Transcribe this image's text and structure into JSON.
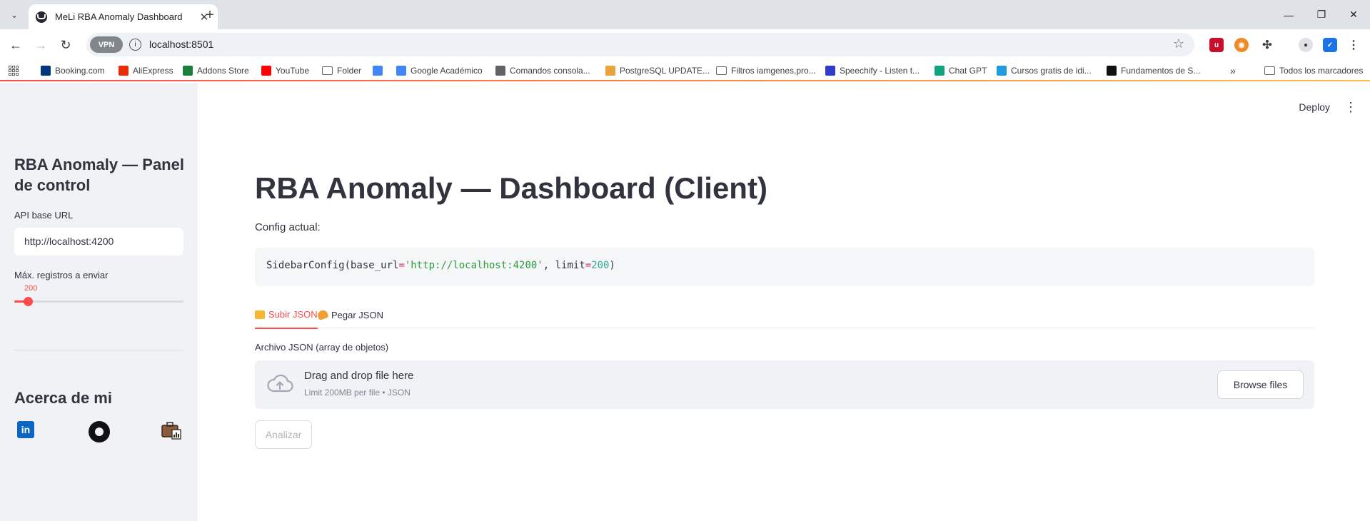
{
  "browser": {
    "tab_title": "MeLi RBA Anomaly Dashboard",
    "url": "localhost:8501",
    "vpn_label": "VPN",
    "bookmarks": [
      {
        "label": "Booking.com",
        "icon": "booking-icon",
        "color": "#003580"
      },
      {
        "label": "AliExpress",
        "icon": "aliexpress-icon",
        "color": "#e62e04"
      },
      {
        "label": "Addons Store",
        "icon": "addons-icon",
        "color": "#1a7f3c"
      },
      {
        "label": "YouTube",
        "icon": "youtube-icon",
        "color": "#ff0000"
      },
      {
        "label": "Folder",
        "icon": "folder-icon",
        "color": "#5f6368"
      },
      {
        "label": "",
        "icon": "grid-app-icon",
        "color": "#4285f4"
      },
      {
        "label": "Google Académico",
        "icon": "google-icon",
        "color": "#4285f4"
      },
      {
        "label": "Comandos consola...",
        "icon": "doc-icon",
        "color": "#5f6368"
      },
      {
        "label": "PostgreSQL UPDATE...",
        "icon": "chrome-icon",
        "color": "#e8a33d"
      },
      {
        "label": "Filtros iamgenes,pro...",
        "icon": "folder-icon",
        "color": "#5f6368"
      },
      {
        "label": "Speechify - Listen t...",
        "icon": "speechify-icon",
        "color": "#2f3bc9"
      },
      {
        "label": "Chat GPT",
        "icon": "chatgpt-icon",
        "color": "#10a37f"
      },
      {
        "label": "Cursos gratis de idi...",
        "icon": "cursos-icon",
        "color": "#1f9bde"
      },
      {
        "label": "Fundamentos de S...",
        "icon": "fundamentos-icon",
        "color": "#111111"
      }
    ],
    "all_bookmarks": "Todos los marcadores"
  },
  "sidebar": {
    "title": "RBA Anomaly — Panel de control",
    "api_label": "API base URL",
    "api_value": "http://localhost:4200",
    "limit_label": "Máx. registros a enviar",
    "limit_value": "200",
    "limit_fraction": 0.08,
    "about_title": "Acerca de mi",
    "accent_color": "#ff4b4b"
  },
  "main": {
    "deploy_label": "Deploy",
    "title": "RBA Anomaly — Dashboard (Client)",
    "config_label": "Config actual:",
    "code": {
      "prefix": "SidebarConfig(base_url",
      "eq1": "=",
      "url": "'http://localhost:4200'",
      "mid": ", limit",
      "eq2": "=",
      "limit": "200",
      "suffix": ")"
    },
    "tabs": [
      {
        "label": "Subir JSON",
        "active": true
      },
      {
        "label": "Pegar JSON",
        "active": false
      }
    ],
    "upload_label": "Archivo JSON (array de objetos)",
    "dropzone_title": "Drag and drop file here",
    "dropzone_sub": "Limit 200MB per file • JSON",
    "browse_label": "Browse files",
    "analyze_label": "Analizar"
  }
}
